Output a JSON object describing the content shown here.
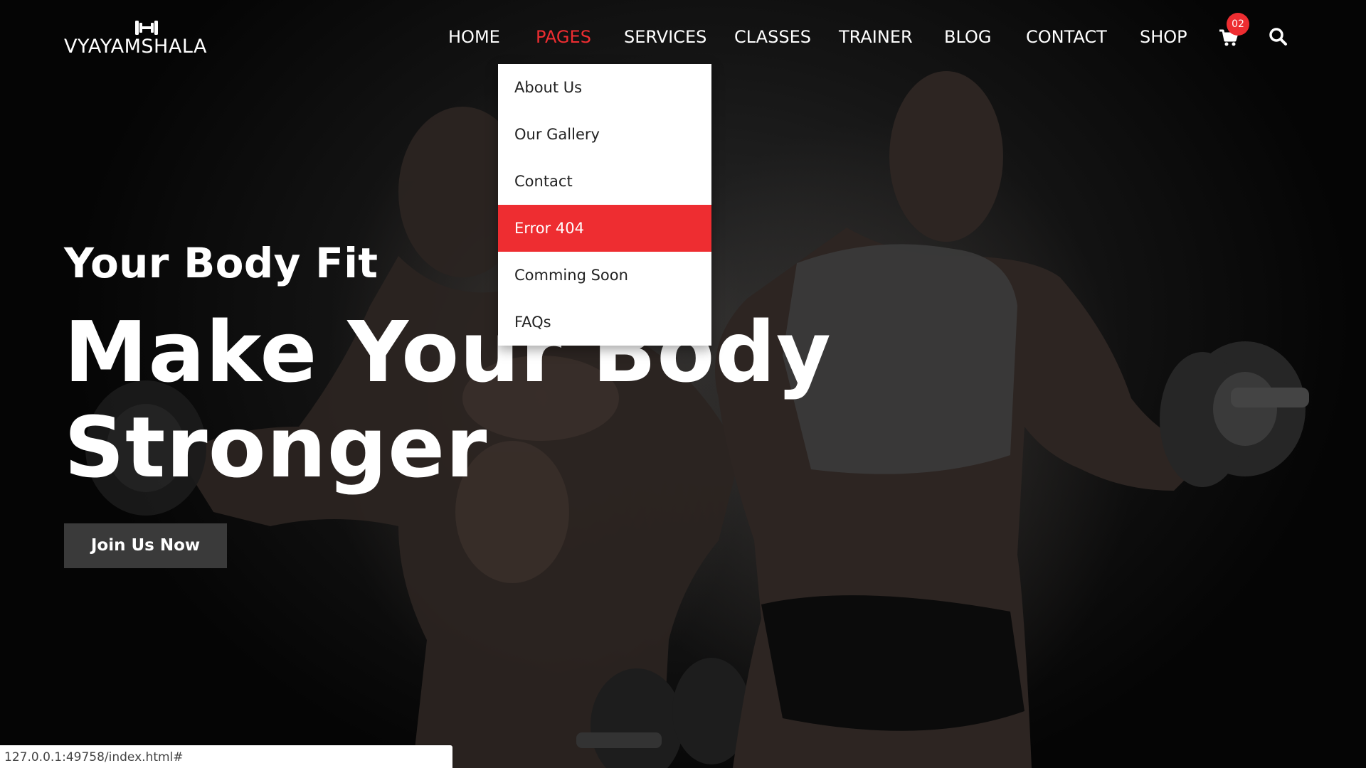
{
  "brand": {
    "name": "VYAYAMSHALA",
    "logo_icon": "dumbbell-icon"
  },
  "nav": {
    "items": [
      {
        "label": "HOME",
        "active": false
      },
      {
        "label": "PAGES",
        "active": true
      },
      {
        "label": "SERVICES",
        "active": false
      },
      {
        "label": "CLASSES",
        "active": false
      },
      {
        "label": "TRAINER",
        "active": false
      },
      {
        "label": "BLOG",
        "active": false
      },
      {
        "label": "CONTACT",
        "active": false
      },
      {
        "label": "SHOP",
        "active": false
      }
    ],
    "cart_icon": "cart-icon",
    "cart_count": "02",
    "search_icon": "search-icon"
  },
  "dropdown": {
    "items": [
      {
        "label": "About Us",
        "highlighted": false
      },
      {
        "label": "Our Gallery",
        "highlighted": false
      },
      {
        "label": "Contact",
        "highlighted": false
      },
      {
        "label": "Error 404",
        "highlighted": true
      },
      {
        "label": "Comming Soon",
        "highlighted": false
      },
      {
        "label": "FAQs",
        "highlighted": false
      }
    ]
  },
  "hero": {
    "subtitle": "Your Body Fit",
    "title_line1": "Make Your Body",
    "title_line2": "Stronger",
    "cta_label": "Join Us Now"
  },
  "status_bar": {
    "url": "127.0.0.1:49758/index.html#"
  },
  "colors": {
    "accent": "#ee2d31",
    "background": "#0a0a0a",
    "button": "#3a3a3a",
    "text": "#ffffff"
  }
}
